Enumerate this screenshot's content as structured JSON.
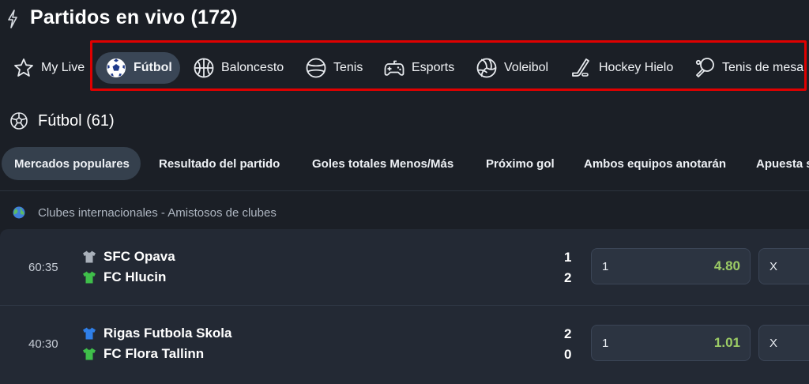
{
  "header": {
    "title": "Partidos en vivo (172)",
    "icon": "bolt-icon"
  },
  "sports": [
    {
      "label": "My Live",
      "icon": "star-icon"
    },
    {
      "label": "Fútbol",
      "icon": "soccer-ball-icon",
      "active": true
    },
    {
      "label": "Baloncesto",
      "icon": "basketball-icon"
    },
    {
      "label": "Tenis",
      "icon": "tennis-ball-icon"
    },
    {
      "label": "Esports",
      "icon": "gamepad-icon"
    },
    {
      "label": "Voleibol",
      "icon": "volleyball-icon"
    },
    {
      "label": "Hockey Hielo",
      "icon": "hockey-stick-icon"
    },
    {
      "label": "Tenis de mesa",
      "icon": "ping-pong-icon"
    }
  ],
  "section": {
    "title": "Fútbol (61)",
    "icon": "soccer-ball-icon"
  },
  "market_tabs": [
    {
      "label": "Mercados populares",
      "active": true
    },
    {
      "label": "Resultado del partido"
    },
    {
      "label": "Goles totales Menos/Más"
    },
    {
      "label": "Próximo gol"
    },
    {
      "label": "Ambos equipos anotarán"
    },
    {
      "label": "Apuesta s"
    }
  ],
  "league": {
    "name": "Clubes internacionales - Amistosos de clubes",
    "icon": "globe-icon"
  },
  "events": [
    {
      "time": "60:35",
      "home": {
        "name": "SFC Opava",
        "shirt_color": "#a9b0ba",
        "score": "1"
      },
      "away": {
        "name": "FC Hlucin",
        "shirt_color": "#3fbf4a",
        "score": "2"
      },
      "odds": [
        {
          "label": "1",
          "value": "4.80"
        },
        {
          "label": "X",
          "value": ""
        }
      ]
    },
    {
      "time": "40:30",
      "home": {
        "name": "Rigas Futbola Skola",
        "shirt_color": "#2f7fe8",
        "score": "2"
      },
      "away": {
        "name": "FC Flora Tallinn",
        "shirt_color": "#3fbf4a",
        "score": "0"
      },
      "odds": [
        {
          "label": "1",
          "value": "1.01"
        },
        {
          "label": "X",
          "value": ""
        }
      ]
    }
  ],
  "colors": {
    "background": "#1b1f26",
    "odd_value": "#9ccc65",
    "highlight": "#e00000"
  }
}
